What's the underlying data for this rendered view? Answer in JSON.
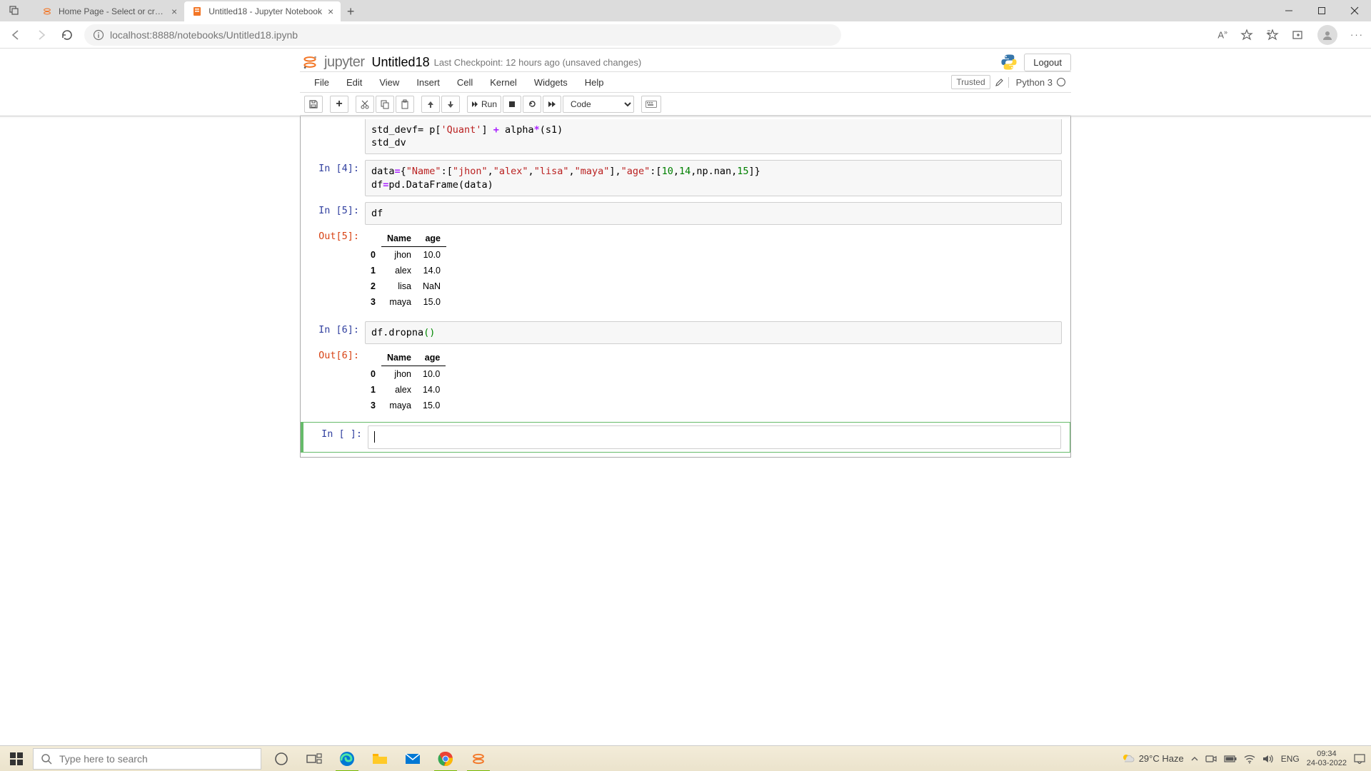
{
  "browser": {
    "tabs": [
      {
        "title": "Home Page - Select or create a n",
        "active": false
      },
      {
        "title": "Untitled18 - Jupyter Notebook",
        "active": true
      }
    ],
    "url_host": "localhost",
    "url_path": ":8888/notebooks/Untitled18.ipynb"
  },
  "jupyter": {
    "brand": "jupyter",
    "title": "Untitled18",
    "checkpoint_label": "Last Checkpoint:",
    "checkpoint_time": "12 hours ago",
    "unsaved": "(unsaved changes)",
    "logout": "Logout",
    "menus": [
      "File",
      "Edit",
      "View",
      "Insert",
      "Cell",
      "Kernel",
      "Widgets",
      "Help"
    ],
    "trusted": "Trusted",
    "kernel": "Python 3",
    "toolbar": {
      "run": "Run",
      "celltype": "Code"
    }
  },
  "cells": {
    "c0": {
      "in_label": "",
      "line1a": "std_devf= p[",
      "line1b": "'Quant'",
      "line1c": "] ",
      "line1d": "+",
      "line1e": " alpha",
      "line1f": "*",
      "line1g": "(s1)",
      "line2": "std_dv"
    },
    "c4": {
      "in_label": "In [4]:",
      "l1a": "data",
      "l1b": "=",
      "l1c": "{",
      "l1d": "\"Name\"",
      "l1e": ":[",
      "l1f": "\"jhon\"",
      "l1g": ",",
      "l1h": "\"alex\"",
      "l1i": ",",
      "l1j": "\"lisa\"",
      "l1k": ",",
      "l1l": "\"maya\"",
      "l1m": "],",
      "l1n": "\"age\"",
      "l1o": ":[",
      "l1p": "10",
      "l1q": ",",
      "l1r": "14",
      "l1s": ",np.nan,",
      "l1t": "15",
      "l1u": "]}",
      "l2a": "df",
      "l2b": "=",
      "l2c": "pd.DataFrame(data)"
    },
    "c5": {
      "in_label": "In [5]:",
      "code": "df",
      "out_label": "Out[5]:"
    },
    "c6": {
      "in_label": "In [6]:",
      "code_a": "df.dropna",
      "code_b": "()",
      "out_label": "Out[6]:"
    },
    "c7": {
      "in_label": "In [ ]:",
      "code": ""
    }
  },
  "df5": {
    "headers": [
      "",
      "Name",
      "age"
    ],
    "rows": [
      {
        "idx": "0",
        "name": "jhon",
        "age": "10.0"
      },
      {
        "idx": "1",
        "name": "alex",
        "age": "14.0"
      },
      {
        "idx": "2",
        "name": "lisa",
        "age": "NaN"
      },
      {
        "idx": "3",
        "name": "maya",
        "age": "15.0"
      }
    ]
  },
  "df6": {
    "headers": [
      "",
      "Name",
      "age"
    ],
    "rows": [
      {
        "idx": "0",
        "name": "jhon",
        "age": "10.0"
      },
      {
        "idx": "1",
        "name": "alex",
        "age": "14.0"
      },
      {
        "idx": "3",
        "name": "maya",
        "age": "15.0"
      }
    ]
  },
  "taskbar": {
    "search_placeholder": "Type here to search",
    "weather": "29°C  Haze",
    "lang": "ENG",
    "time": "09:34",
    "date": "24-03-2022"
  }
}
